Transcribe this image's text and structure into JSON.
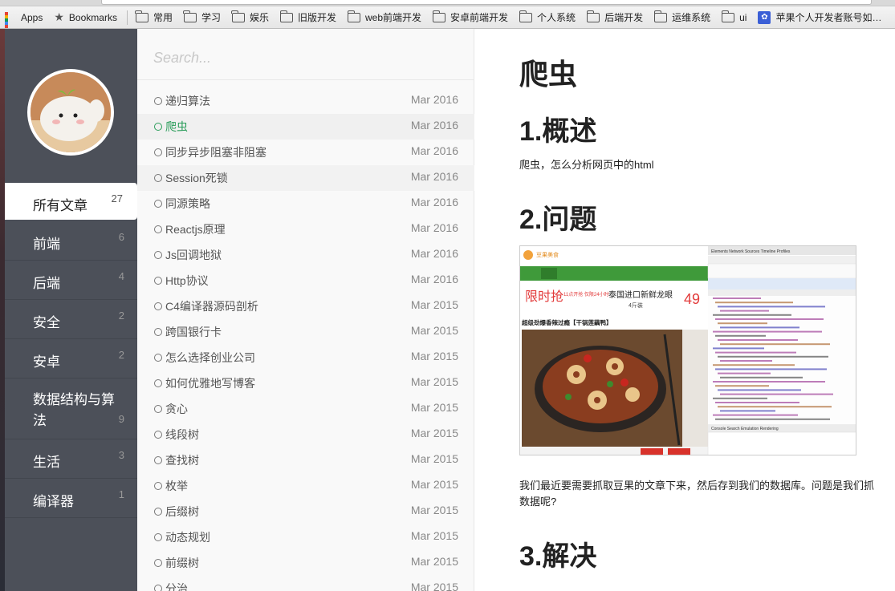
{
  "bookmarks": [
    {
      "label": "Apps",
      "icon": "apps-icon"
    },
    {
      "label": "Bookmarks",
      "icon": "star-icon"
    },
    {
      "label": "常用",
      "icon": "folder-icon"
    },
    {
      "label": "学习",
      "icon": "folder-icon"
    },
    {
      "label": "娱乐",
      "icon": "folder-icon"
    },
    {
      "label": "旧版开发",
      "icon": "folder-icon"
    },
    {
      "label": "web前端开发",
      "icon": "folder-icon"
    },
    {
      "label": "安卓前端开发",
      "icon": "folder-icon"
    },
    {
      "label": "个人系统",
      "icon": "folder-icon"
    },
    {
      "label": "后端开发",
      "icon": "folder-icon"
    },
    {
      "label": "运维系统",
      "icon": "folder-icon"
    },
    {
      "label": "ui",
      "icon": "folder-icon"
    },
    {
      "label": "苹果个人开发者账号如…",
      "icon": "paw-icon"
    }
  ],
  "sidebar": {
    "categories": [
      {
        "label": "所有文章",
        "count": "27"
      },
      {
        "label": "前端",
        "count": "6"
      },
      {
        "label": "后端",
        "count": "4"
      },
      {
        "label": "安全",
        "count": "2"
      },
      {
        "label": "安卓",
        "count": "2"
      },
      {
        "label": "数据结构与算法",
        "count": "9"
      },
      {
        "label": "生活",
        "count": "3"
      },
      {
        "label": "编译器",
        "count": "1"
      }
    ]
  },
  "search": {
    "placeholder": "Search..."
  },
  "articles": [
    {
      "title": "递归算法",
      "date": "Mar 2016"
    },
    {
      "title": "爬虫",
      "date": "Mar 2016"
    },
    {
      "title": "同步异步阻塞非阻塞",
      "date": "Mar 2016"
    },
    {
      "title": "Session死锁",
      "date": "Mar 2016"
    },
    {
      "title": "同源策略",
      "date": "Mar 2016"
    },
    {
      "title": "Reactjs原理",
      "date": "Mar 2016"
    },
    {
      "title": "Js回调地狱",
      "date": "Mar 2016"
    },
    {
      "title": "Http协议",
      "date": "Mar 2016"
    },
    {
      "title": "C4编译器源码剖析",
      "date": "Mar 2015"
    },
    {
      "title": "跨国银行卡",
      "date": "Mar 2015"
    },
    {
      "title": "怎么选择创业公司",
      "date": "Mar 2015"
    },
    {
      "title": "如何优雅地写博客",
      "date": "Mar 2015"
    },
    {
      "title": "贪心",
      "date": "Mar 2015"
    },
    {
      "title": "线段树",
      "date": "Mar 2015"
    },
    {
      "title": "查找树",
      "date": "Mar 2015"
    },
    {
      "title": "枚举",
      "date": "Mar 2015"
    },
    {
      "title": "后缀树",
      "date": "Mar 2015"
    },
    {
      "title": "动态规划",
      "date": "Mar 2015"
    },
    {
      "title": "前缀树",
      "date": "Mar 2015"
    },
    {
      "title": "分治",
      "date": "Mar 2015"
    }
  ],
  "post": {
    "title": "爬虫",
    "h_overview": "1.概述",
    "overview_text": "爬虫，怎么分析网页中的html",
    "h_problem": "2.问题",
    "problem_text_1": "我们最近要需要抓取豆果的文章下来，然后存到我们的数据库。问题是我们抓",
    "problem_text_2": "数据呢?",
    "h_solution": "3.解决",
    "screenshot": {
      "site_name": "豆果美食",
      "promo_label": "限时抢",
      "promo_sub": "11点开抢 仅限24小时",
      "promo_item": "泰国进口新鲜龙眼",
      "promo_qty": "4斤装",
      "promo_price": "49",
      "dish_title": "超级劲爆香辣过瘾【干锅莲藕鸭】",
      "devtools_tabs": [
        "Elements",
        "Network",
        "Sources",
        "Timeline",
        "Profiles"
      ],
      "console_tabs": [
        "Console",
        "Search",
        "Emulation",
        "Rendering"
      ]
    }
  }
}
